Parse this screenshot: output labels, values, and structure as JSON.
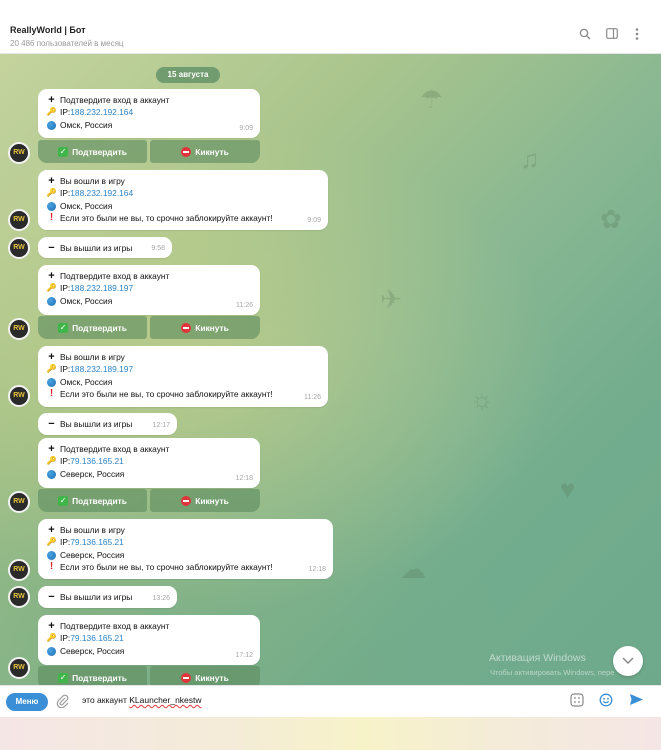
{
  "header": {
    "title": "ReallyWorld | Бот",
    "subtitle": "20 486 пользователей в месяц"
  },
  "chat": {
    "date": "15 августа",
    "avatar_text": "RW",
    "messages": [
      {
        "lines": [
          "Подтвердите вход в аккаунт",
          "IP: ",
          "Омск, Россия"
        ],
        "ip": "188.232.192.164",
        "time": "9:09"
      },
      {
        "lines": [
          "Вы вошли в игру",
          "IP: ",
          "Омск, Россия",
          "Если это были не вы, то срочно заблокируйте аккаунт!"
        ],
        "ip": "188.232.192.164",
        "time": "9:09"
      },
      {
        "lines": [
          "Вы вышли из игры"
        ],
        "time": "9:58"
      },
      {
        "lines": [
          "Подтвердите вход в аккаунт",
          "IP: ",
          "Омск, Россия"
        ],
        "ip": "188.232.189.197",
        "time": "11:26"
      },
      {
        "lines": [
          "Вы вошли в игру",
          "IP: ",
          "Омск, Россия",
          "Если это были не вы, то срочно заблокируйте аккаунт!"
        ],
        "ip": "188.232.189.197",
        "time": "11:26"
      },
      {
        "lines": [
          "Вы вышли из игры"
        ],
        "time": "12:17"
      },
      {
        "lines": [
          "Подтвердите вход в аккаунт",
          "IP: ",
          "Северск, Россия"
        ],
        "ip": "79.136.165.21",
        "time": "12:18"
      },
      {
        "lines": [
          "Вы вошли в игру",
          "IP: ",
          "Северск, Россия",
          "Если это были не вы, то срочно заблокируйте аккаунт!"
        ],
        "ip": "79.136.165.21",
        "time": "12:18"
      },
      {
        "lines": [
          "Вы вышли из игры"
        ],
        "time": "13:26"
      },
      {
        "lines": [
          "Подтвердите вход в аккаунт",
          "IP: ",
          "Северск, Россия"
        ],
        "ip": "79.136.165.21",
        "time": "17:12"
      }
    ],
    "buttons": {
      "confirm": "Подтвердить",
      "kick": "Кикнуть"
    }
  },
  "watermark": {
    "title": "Активация Windows",
    "subtitle": "Чтобы активировать Windows, пере"
  },
  "composer": {
    "menu_label": "Меню",
    "text_prefix": "это аккаунт ",
    "text_underlined": "KLauncher_nkestw"
  },
  "icons": [
    "search-icon",
    "sidebar-toggle-icon",
    "more-icon",
    "attach-icon",
    "commands-icon",
    "emoji-icon",
    "send-icon",
    "scroll-down-icon"
  ]
}
